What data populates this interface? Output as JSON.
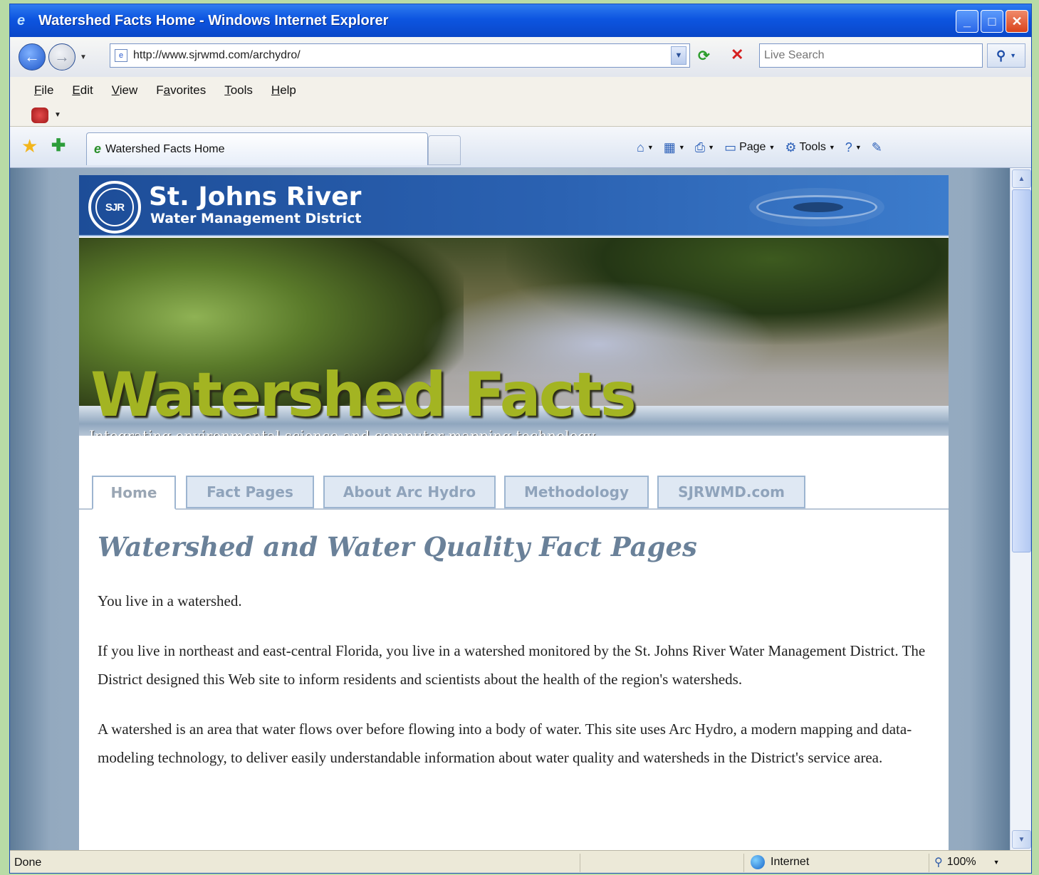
{
  "window": {
    "title": "Watershed Facts Home - Windows Internet Explorer",
    "buttons": {
      "minimize": "_",
      "maximize": "□",
      "close": "✕"
    }
  },
  "address_bar": {
    "url": "http://www.sjrwmd.com/archydro/",
    "search_placeholder": "Live Search"
  },
  "menu": [
    "File",
    "Edit",
    "View",
    "Favorites",
    "Tools",
    "Help"
  ],
  "menu_access_keys": [
    "F",
    "E",
    "V",
    "a",
    "T",
    "H"
  ],
  "tab": {
    "label": "Watershed Facts Home"
  },
  "command_bar": {
    "page_label": "Page",
    "tools_label": "Tools"
  },
  "site": {
    "logo_text": "SJR",
    "title": "St. Johns River",
    "subtitle": "Water Management District",
    "banner_title": "Watershed Facts",
    "banner_tagline": "Integrating environmental science and computer mapping technology",
    "tabs": [
      "Home",
      "Fact Pages",
      "About Arc Hydro",
      "Methodology",
      "SJRWMD.com"
    ],
    "active_tab": "Home"
  },
  "content": {
    "heading": "Watershed and Water Quality Fact Pages",
    "paragraphs": [
      "You live in a watershed.",
      "If you live in northeast and east-central Florida, you live in a watershed monitored by the St. Johns River Water Management District. The District designed this Web site to inform residents and scientists about the health of the region's watersheds.",
      "A watershed is an area that water flows over before flowing into a body of water. This site uses Arc Hydro, a modern mapping and data-modeling technology, to deliver easily understandable information about water quality and watersheds in the District's service area."
    ]
  },
  "status_bar": {
    "status": "Done",
    "zone": "Internet",
    "zoom": "100%"
  },
  "icons": [
    "ie-logo-icon",
    "back-icon",
    "forward-icon",
    "page-icon",
    "refresh-icon",
    "stop-icon",
    "search-icon",
    "favorites-star-icon",
    "add-favorites-icon",
    "home-icon",
    "feeds-icon",
    "print-icon",
    "page-icon",
    "tools-gear-icon",
    "help-icon",
    "research-icon",
    "globe-icon",
    "zoom-icon"
  ],
  "colors": {
    "titlebar": "#0d55e0",
    "banner_title": "#a3b422",
    "heading": "#6a8199",
    "header_blue": "#2b62b2"
  }
}
